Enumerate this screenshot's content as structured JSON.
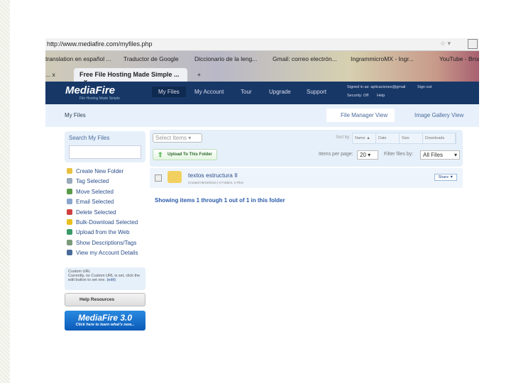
{
  "browser": {
    "url": "http://www.mediafire.com/myfiles.php",
    "bookmarks": [
      "translation en español ...",
      "Traductor de Google",
      "Diccionario de la leng...",
      "Gmail: correo electrón...",
      "IngrammicroMX - Ingr...",
      "YouTube - Broa"
    ],
    "tab_title": "Free File Hosting Made Simple ...",
    "tab_close": "x",
    "new_tab": "+",
    "prev_tab": "... x"
  },
  "nav": {
    "logo": "MediaFire",
    "tagline": "File Hosting Made Simple",
    "items": [
      "My Files",
      "My Account",
      "Tour",
      "Upgrade",
      "Support"
    ],
    "signed_in": "Signed in as: aplicaciones@gmail",
    "sign_out": "Sign out",
    "security": "Security: Off",
    "help": "Help"
  },
  "subheader": {
    "title": "My Files",
    "views": [
      "File Manager View",
      "Image Gallery View"
    ]
  },
  "sidebar": {
    "search_label": "Search My Files",
    "actions": [
      {
        "label": "Create New Folder",
        "color": "#e8c040"
      },
      {
        "label": "Tag Selected",
        "color": "#9ab"
      },
      {
        "label": "Move Selected",
        "color": "#5a9a4a"
      },
      {
        "label": "Email Selected",
        "color": "#8aa6cc"
      },
      {
        "label": "Delete Selected",
        "color": "#d04040"
      },
      {
        "label": "Bulk-Download Selected",
        "color": "#e8c020"
      },
      {
        "label": "Upload from the Web",
        "color": "#3a9a6a"
      },
      {
        "label": "Show Descriptions/Tags",
        "color": "#7a9a7a"
      },
      {
        "label": "View my Account Details",
        "color": "#4a6a9a"
      }
    ],
    "custom_url_title": "Custom URL",
    "custom_url_text": "Currently, no Custom URL is set, click the edit button to set one.",
    "custom_url_edit": "(edit)",
    "help": "Help Resources",
    "promo_title": "MediaFire 3.0",
    "promo_sub": "Click here to learn what's new..."
  },
  "toolbar": {
    "select_items": "Select Items",
    "sort_by": "Sort by:",
    "sort_options": [
      "Name ▲",
      "Date",
      "Size",
      "Downloads"
    ],
    "upload": "Upload To This Folder",
    "items_per_page_label": "Items per page:",
    "items_per_page": "20",
    "filter_label": "Filter files by:",
    "filter": "All Files"
  },
  "files": [
    {
      "name": "textos estructura II",
      "meta": "Created 05/19/2010 | 0 Folders, 0 Files",
      "share": "Share ▼"
    }
  ],
  "status": "Showing items 1 through 1 out of 1 in this folder"
}
